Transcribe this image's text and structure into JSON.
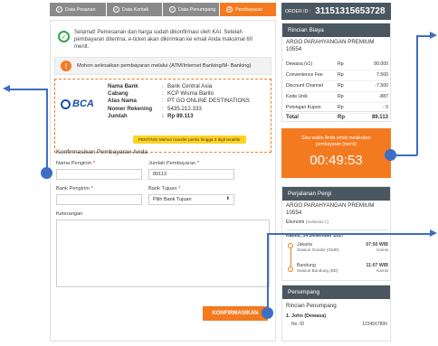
{
  "steps": [
    {
      "label": "Data Pesanan",
      "done": true
    },
    {
      "label": "Data Kontak",
      "done": true
    },
    {
      "label": "Data Penumpang",
      "done": true
    },
    {
      "label": "Pembayaran",
      "num": "4",
      "done": false
    }
  ],
  "notice_success": "Selamat! Pemesanan dan harga sudah dikonfirmasi oleh KAI. Setelah pembayaran diterima, e-ticket akan dikirimkan ke email Anda maksimal 60 menit.",
  "notice_info": "Mohon selesaikan pembayaran melalui (ATM/Internet Banking/M- Banking)",
  "bank": {
    "logo": "BCA",
    "rows": [
      {
        "k": "Nama Bank",
        "v": "Bank Central Asia"
      },
      {
        "k": "Cabang",
        "v": "KCP Wisma Barito"
      },
      {
        "k": "Atas Nama",
        "v": "PT GO ONLINE DESTINATIONS"
      },
      {
        "k": "Nomer Rekening",
        "v": "5435.212.333"
      },
      {
        "k": "Jumlah",
        "v": "Rp 89.113"
      }
    ],
    "warning": "PENTING! Mohon transfer persis hingga 3 digit terakhir"
  },
  "form": {
    "title": "Konfirmasikan Pembayaran Anda",
    "nama_pengirim": "Nama Pengirim",
    "jumlah_pembayaran": "Jumlah Pembayaran",
    "jumlah_value": "89113",
    "bank_pengirim": "Bank Pengirim",
    "bank_tujuan": "Bank Tujuan",
    "bank_tujuan_value": "Pilih Bank Tujuan",
    "keterangan": "Keterangan",
    "submit": "KONFIRMASIKAN"
  },
  "order": {
    "label": "ORDER ID :",
    "id": "31151315653728"
  },
  "rincian": {
    "title": "Rincian Biaya",
    "train": "ARGO PARAHYANGAN PREMIUM 10554",
    "items": [
      {
        "k": "Dewasa (x1)",
        "c": "Rp",
        "v": "90.000"
      },
      {
        "k": "Convenience Fee",
        "c": "Rp",
        "v": "7.500"
      },
      {
        "k": "Discount Channel",
        "c": "Rp",
        "v": "-7.500"
      },
      {
        "k": "Kode Unik",
        "c": "Rp",
        "v": "-887"
      },
      {
        "k": "Potongan Kupon",
        "c": "Rp",
        "v": "- 0"
      }
    ],
    "total_label": "Total",
    "total_cur": "Rp",
    "total": "89.113"
  },
  "timer": {
    "text": "Sisa waktu Anda untuk melakukan pembayaran (menit)",
    "value": "00:49:53"
  },
  "perjalanan": {
    "title": "Perjalanan Pergi",
    "train": "ARGO PARAHYANGAN PREMIUM 10554",
    "kelas": "Ekonomi",
    "subkelas": "(Subkelas C)",
    "date": "Kamis, 14 Desember 2017",
    "dep_city": "Jakarta",
    "dep_time": "07:50 WIB",
    "dep_station": "Stasiun Gambir (GMR)",
    "dep_day": "Kamis",
    "arr_city": "Bandung",
    "arr_time": "11:07 WIB",
    "arr_station": "Stasiun Bandung (BD)",
    "arr_day": "Kamis"
  },
  "penumpang": {
    "title": "Penumpang",
    "subtitle": "Rincian Penumpang",
    "name": "1. John (Dewasa)",
    "id_label": "No. ID",
    "id_value": "1234567890"
  },
  "colors": {
    "accent": "#f47a20",
    "header": "#4a5761",
    "annot": "#3d6ec4",
    "bca": "#1b4fa3"
  }
}
